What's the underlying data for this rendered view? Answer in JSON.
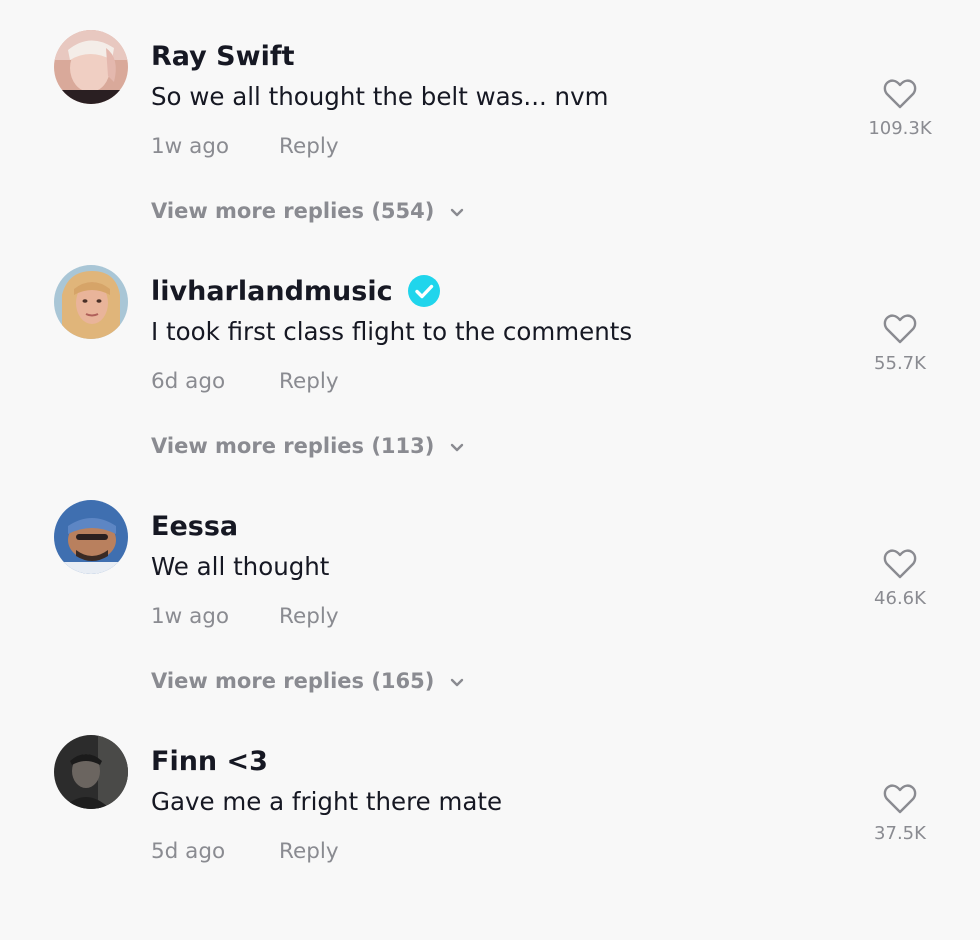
{
  "comments": [
    {
      "username": "Ray Swift",
      "verified": false,
      "text": "So we all thought the belt was... nvm",
      "time": "1w ago",
      "reply_label": "Reply",
      "view_more": "View more replies (554)",
      "likes": "109.3K"
    },
    {
      "username": "livharlandmusic",
      "verified": true,
      "text": "I took first class flight to the comments",
      "time": "6d ago",
      "reply_label": "Reply",
      "view_more": "View more replies (113)",
      "likes": "55.7K"
    },
    {
      "username": "Eessa",
      "verified": false,
      "text": "We all thought",
      "time": "1w ago",
      "reply_label": "Reply",
      "view_more": "View more replies (165)",
      "likes": "46.6K"
    },
    {
      "username": "Finn <3",
      "verified": false,
      "text": "Gave me a fright there mate",
      "time": "5d ago",
      "reply_label": "Reply",
      "view_more": "",
      "likes": "37.5K"
    }
  ],
  "icons": {
    "like": "heart-outline-icon",
    "verified": "verified-badge-icon",
    "expand": "chevron-down-icon"
  },
  "colors": {
    "background": "#f8f8f8",
    "primary_text": "#161823",
    "secondary_text": "#8a8b91",
    "verified": "#20d5ec"
  }
}
